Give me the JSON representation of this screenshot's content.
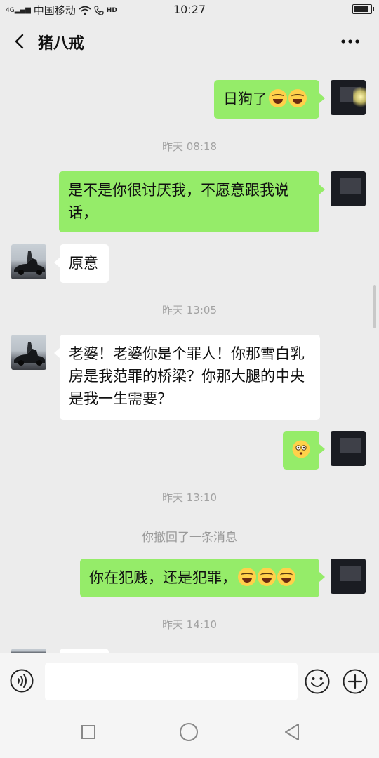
{
  "status_bar": {
    "carrier": "中国移动",
    "network": "4G",
    "hd": "HD",
    "time": "10:27"
  },
  "header": {
    "title": "猪八戒"
  },
  "messages": [
    {
      "type": "sent",
      "text": "日狗了",
      "emoji_count": 2,
      "emoji": "tears-of-joy-emoji"
    },
    {
      "type": "time",
      "text": "昨天 08:18"
    },
    {
      "type": "sent",
      "text": "是不是你很讨厌我，不愿意跟我说话，"
    },
    {
      "type": "received",
      "text": "原意"
    },
    {
      "type": "time",
      "text": "昨天 13:05"
    },
    {
      "type": "received",
      "text": "老婆！老婆你是个罪人！你那雪白乳房是我范罪的桥梁？你那大腿的中央是我一生需要？"
    },
    {
      "type": "sent",
      "emoji_only": "flushed-face-emoji"
    },
    {
      "type": "time",
      "text": "昨天 13:10"
    },
    {
      "type": "recall",
      "text": "你撤回了一条消息"
    },
    {
      "type": "sent",
      "text": "你在犯贱，还是犯罪，",
      "emoji_count": 3,
      "emoji": "tears-of-joy-emoji"
    },
    {
      "type": "time",
      "text": "昨天 14:10"
    }
  ],
  "input_bar": {
    "placeholder": ""
  },
  "colors": {
    "background": "#ececec",
    "sent_bubble": "#95ec69",
    "received_bubble": "#ffffff",
    "timestamp": "#a3a3a3"
  }
}
